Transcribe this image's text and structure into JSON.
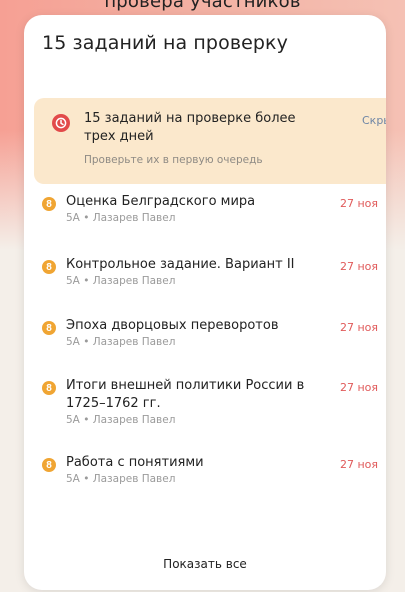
{
  "background_top_text": "провера участников",
  "card": {
    "title": "15 заданий на проверку",
    "alert": {
      "title": "15 заданий на проверке более трех дней",
      "subtitle": "Проверьте их в первую очередь",
      "hide_label": "Скрыть",
      "icon": "clock-icon",
      "accent": "#e24a4a",
      "background": "#fbe8cc"
    },
    "items": [
      {
        "badge": "8",
        "title": "Оценка Белградского мира",
        "meta": "5А • Лазарев Павел",
        "date": "27 ноя"
      },
      {
        "badge": "8",
        "title": "Контрольное задание. Вариант II",
        "meta": "5А • Лазарев Павел",
        "date": "27 ноя"
      },
      {
        "badge": "8",
        "title": "Эпоха дворцовых переворотов",
        "meta": "5А • Лазарев Павел",
        "date": "27 ноя"
      },
      {
        "badge": "8",
        "title": "Итоги внешней политики России в 1725–1762 гг.",
        "meta": "5А • Лазарев Павел",
        "date": "27 ноя"
      },
      {
        "badge": "8",
        "title": "Работа с понятиями",
        "meta": "5А • Лазарев Павел",
        "date": "27 ноя"
      }
    ],
    "show_all_label": "Показать все",
    "colors": {
      "badge": "#f0a533",
      "date": "#e05a5a",
      "link": "#6e86a6"
    }
  }
}
